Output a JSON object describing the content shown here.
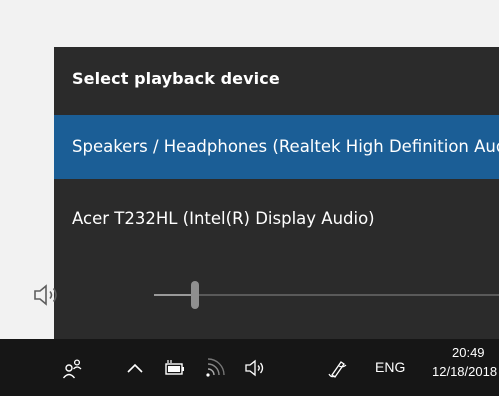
{
  "playback_panel": {
    "title": "Select playback device",
    "devices": [
      {
        "label": "Speakers / Headphones (Realtek High Definition Audio)",
        "selected": true
      },
      {
        "label": "Acer T232HL (Intel(R) Display Audio)",
        "selected": false
      }
    ],
    "volume": {
      "icon": "speaker-icon",
      "level_fraction": 0.12
    }
  },
  "taskbar": {
    "icons": [
      "people-icon",
      "chevron-up-icon",
      "battery-icon",
      "wifi-icon",
      "speaker-icon",
      "pen-icon"
    ],
    "language": "ENG",
    "time": "20:49",
    "date": "12/18/2018"
  },
  "colors": {
    "panel_background": "#2b2b2b",
    "selected_background": "#1b5e96",
    "taskbar_background": "#161616",
    "page_background": "#f2f2f2"
  }
}
